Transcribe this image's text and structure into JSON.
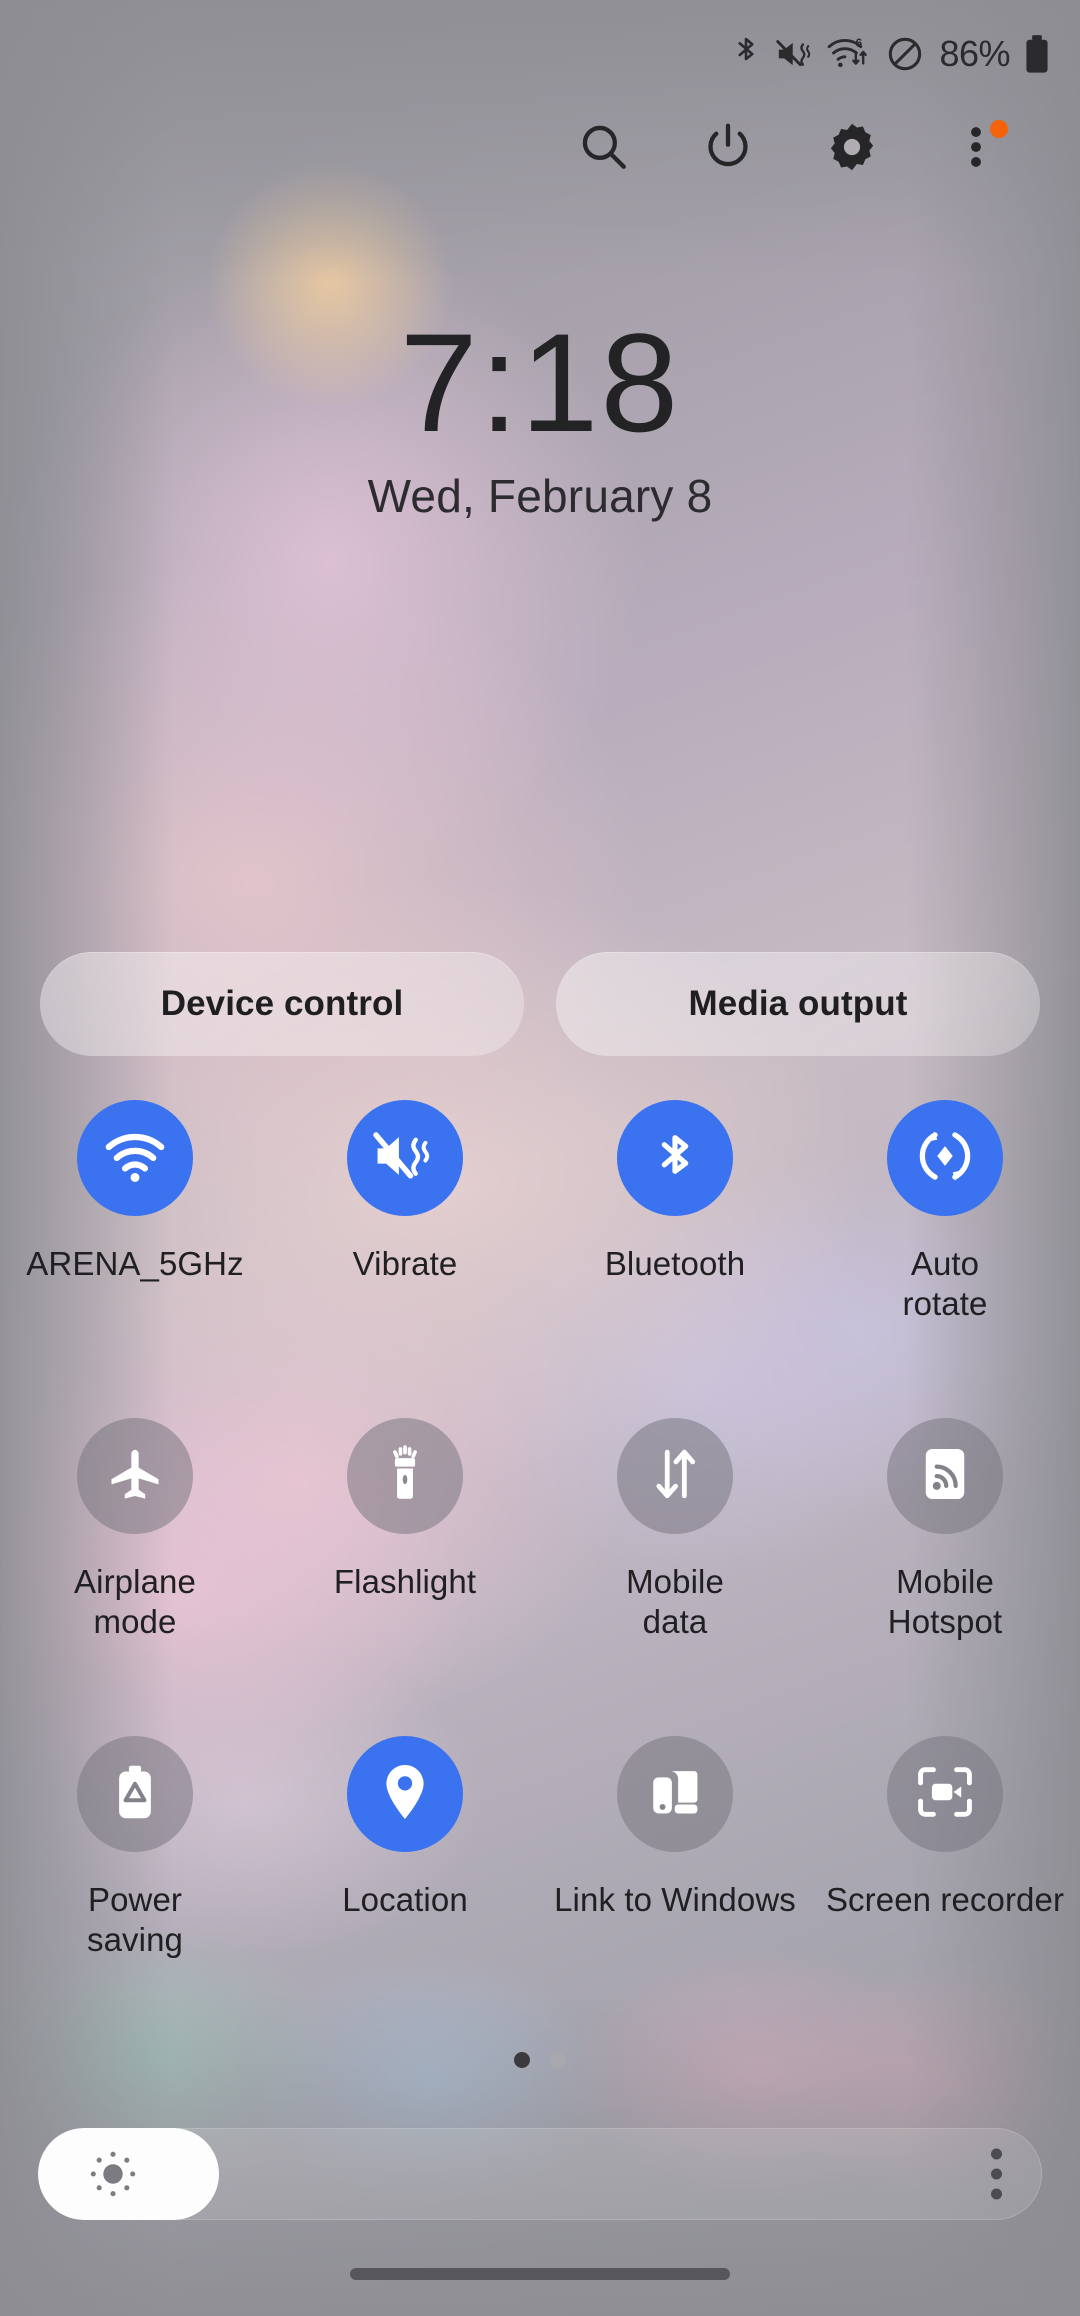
{
  "theme": {
    "accent_blue": "#3b72f0",
    "inactive_grey": "rgba(118,116,126,0.52)",
    "notification_dot": "#f4630c",
    "text_dark": "#202023"
  },
  "status_bar": {
    "icons": [
      {
        "name": "bluetooth-icon",
        "label": "Bluetooth"
      },
      {
        "name": "vibrate-mute-icon",
        "label": "Sound off / vibrate"
      },
      {
        "name": "wifi-6-data-icon",
        "label": "Wi-Fi 6 with data transfer"
      },
      {
        "name": "do-not-disturb-icon",
        "label": "Do not disturb"
      }
    ],
    "battery_percent": "86%",
    "battery_icon": "battery-full-icon"
  },
  "action_row": {
    "buttons": [
      {
        "name": "search-button",
        "icon": "search-icon",
        "label": "Search"
      },
      {
        "name": "power-button",
        "icon": "power-icon",
        "label": "Power"
      },
      {
        "name": "settings-button",
        "icon": "gear-icon",
        "label": "Settings"
      },
      {
        "name": "overflow-menu-button",
        "icon": "more-vertical-icon",
        "label": "More options"
      }
    ],
    "has_notification_dot": true
  },
  "clock": {
    "time": "7:18",
    "date": "Wed, February 8"
  },
  "pills": [
    {
      "name": "device-control-button",
      "label": "Device control"
    },
    {
      "name": "media-output-button",
      "label": "Media output"
    }
  ],
  "toggles": [
    [
      {
        "name": "toggle-wifi",
        "label": "ARENA_5GHz",
        "icon": "wifi-icon",
        "state": "on"
      },
      {
        "name": "toggle-vibrate",
        "label": "Vibrate",
        "icon": "vibrate-mute-icon",
        "state": "on"
      },
      {
        "name": "toggle-bluetooth",
        "label": "Bluetooth",
        "icon": "bluetooth-icon",
        "state": "on"
      },
      {
        "name": "toggle-auto-rotate",
        "label": "Auto\nrotate",
        "icon": "auto-rotate-icon",
        "state": "on"
      }
    ],
    [
      {
        "name": "toggle-airplane-mode",
        "label": "Airplane\nmode",
        "icon": "airplane-icon",
        "state": "off"
      },
      {
        "name": "toggle-flashlight",
        "label": "Flashlight",
        "icon": "flashlight-icon",
        "state": "off"
      },
      {
        "name": "toggle-mobile-data",
        "label": "Mobile\ndata",
        "icon": "data-arrows-icon",
        "state": "off"
      },
      {
        "name": "toggle-mobile-hotspot",
        "label": "Mobile\nHotspot",
        "icon": "hotspot-icon",
        "state": "off"
      }
    ],
    [
      {
        "name": "toggle-power-saving",
        "label": "Power\nsaving",
        "icon": "power-saving-battery-icon",
        "state": "off"
      },
      {
        "name": "toggle-location",
        "label": "Location",
        "icon": "location-pin-icon",
        "state": "on"
      },
      {
        "name": "toggle-link-to-windows",
        "label": "Link to Windows",
        "icon": "link-to-windows-icon",
        "state": "off"
      },
      {
        "name": "toggle-screen-recorder",
        "label": "Screen recorder",
        "icon": "screen-recorder-icon",
        "state": "off"
      }
    ]
  ],
  "page_indicator": {
    "total": 2,
    "active_index": 0
  },
  "brightness": {
    "name": "brightness-slider",
    "percent": 18,
    "sun_icon": "brightness-sun-icon",
    "menu_icon": "more-vertical-icon"
  }
}
